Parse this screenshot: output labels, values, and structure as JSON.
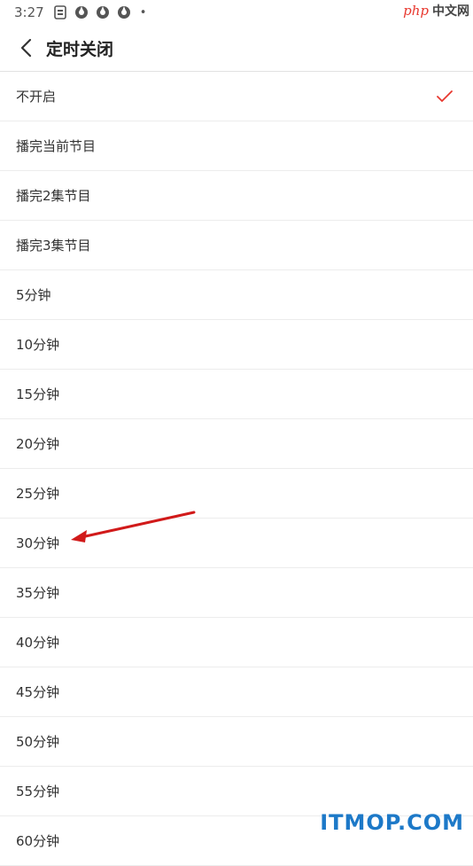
{
  "status_bar": {
    "time": "3:27",
    "icons": [
      "sim-card-icon",
      "vpn-key-icon",
      "vpn-key-icon",
      "vpn-key-icon"
    ],
    "dot": "•"
  },
  "watermark_top": {
    "php": "php",
    "text": "中文网"
  },
  "header": {
    "back_icon": "chevron-left-icon",
    "title": "定时关闭"
  },
  "list": {
    "items": [
      {
        "label": "不开启",
        "selected": true
      },
      {
        "label": "播完当前节目",
        "selected": false
      },
      {
        "label": "播完2集节目",
        "selected": false
      },
      {
        "label": "播完3集节目",
        "selected": false
      },
      {
        "label": "5分钟",
        "selected": false
      },
      {
        "label": "10分钟",
        "selected": false
      },
      {
        "label": "15分钟",
        "selected": false
      },
      {
        "label": "20分钟",
        "selected": false
      },
      {
        "label": "25分钟",
        "selected": false
      },
      {
        "label": "30分钟",
        "selected": false
      },
      {
        "label": "35分钟",
        "selected": false
      },
      {
        "label": "40分钟",
        "selected": false
      },
      {
        "label": "45分钟",
        "selected": false
      },
      {
        "label": "50分钟",
        "selected": false
      },
      {
        "label": "55分钟",
        "selected": false
      },
      {
        "label": "60分钟",
        "selected": false
      }
    ]
  },
  "colors": {
    "accent": "#e8382f",
    "arrow": "#d11a1a",
    "watermark": "#1d79c8"
  },
  "watermark_bottom": "ITMOP.COM"
}
